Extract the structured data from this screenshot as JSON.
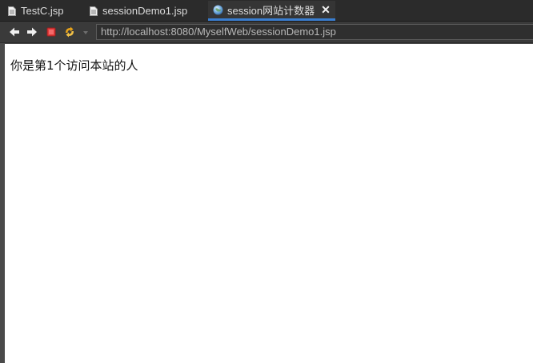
{
  "tabs": [
    {
      "label": "TestC.jsp",
      "active": false
    },
    {
      "label": "sessionDemo1.jsp",
      "active": false
    },
    {
      "label": "session网站计数器",
      "active": true,
      "close_glyph": "✕"
    }
  ],
  "toolbar": {
    "back_icon": "arrow-left-icon",
    "forward_icon": "arrow-right-icon",
    "stop_icon": "stop-icon",
    "refresh_icon": "refresh-icon",
    "url": "http://localhost:8080/MyselfWeb/sessionDemo1.jsp"
  },
  "page": {
    "message": "你是第1个访问本站的人"
  },
  "colors": {
    "accent": "#3a7ed0",
    "stop": "#e23b3b",
    "refresh": "#e6a21a"
  }
}
